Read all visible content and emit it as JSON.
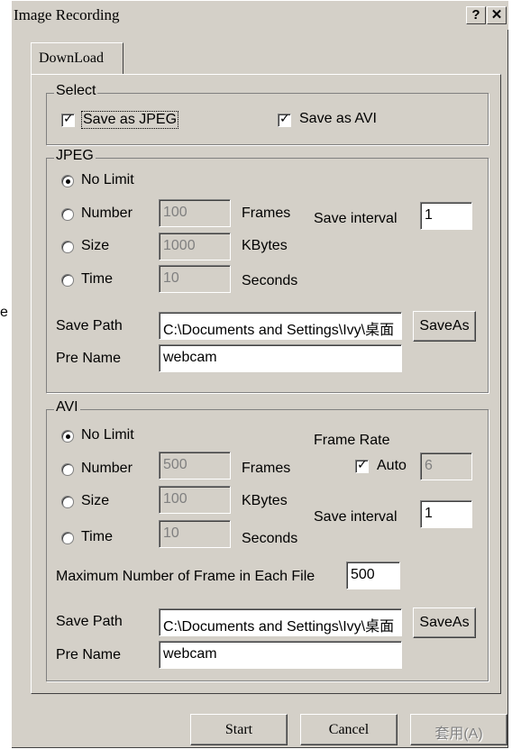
{
  "window": {
    "title": "Image Recording",
    "help_label": "?",
    "close_label": "✕"
  },
  "side_label": "e",
  "tab": {
    "label": "DownLoad"
  },
  "select": {
    "title": "Select",
    "save_jpeg": {
      "label": "Save as JPEG",
      "checked": true
    },
    "save_avi": {
      "label": "Save as AVI",
      "checked": true
    }
  },
  "jpeg": {
    "title": "JPEG",
    "no_limit": "No Limit",
    "number": {
      "label": "Number",
      "value": "100",
      "unit": "Frames"
    },
    "size": {
      "label": "Size",
      "value": "1000",
      "unit": "KBytes"
    },
    "time": {
      "label": "Time",
      "value": "10",
      "unit": "Seconds"
    },
    "selected": "no_limit",
    "save_interval": {
      "label": "Save interval",
      "value": "1"
    },
    "save_path": {
      "label": "Save Path",
      "value": "C:\\Documents and Settings\\Ivy\\桌面",
      "button": "SaveAs"
    },
    "pre_name": {
      "label": "Pre Name",
      "value": "webcam"
    }
  },
  "avi": {
    "title": "AVI",
    "no_limit": "No Limit",
    "number": {
      "label": "Number",
      "value": "500",
      "unit": "Frames"
    },
    "size": {
      "label": "Size",
      "value": "100",
      "unit": "KBytes"
    },
    "time": {
      "label": "Time",
      "value": "10",
      "unit": "Seconds"
    },
    "selected": "no_limit",
    "frame_rate": {
      "label": "Frame Rate",
      "auto_label": "Auto",
      "auto_checked": true,
      "value": "6"
    },
    "save_interval": {
      "label": "Save interval",
      "value": "1"
    },
    "max_frames": {
      "label": "Maximum Number of Frame in Each File",
      "value": "500"
    },
    "save_path": {
      "label": "Save Path",
      "value": "C:\\Documents and Settings\\Ivy\\桌面",
      "button": "SaveAs"
    },
    "pre_name": {
      "label": "Pre Name",
      "value": "webcam"
    }
  },
  "footer": {
    "start": "Start",
    "cancel": "Cancel",
    "apply": "套用(A)"
  }
}
